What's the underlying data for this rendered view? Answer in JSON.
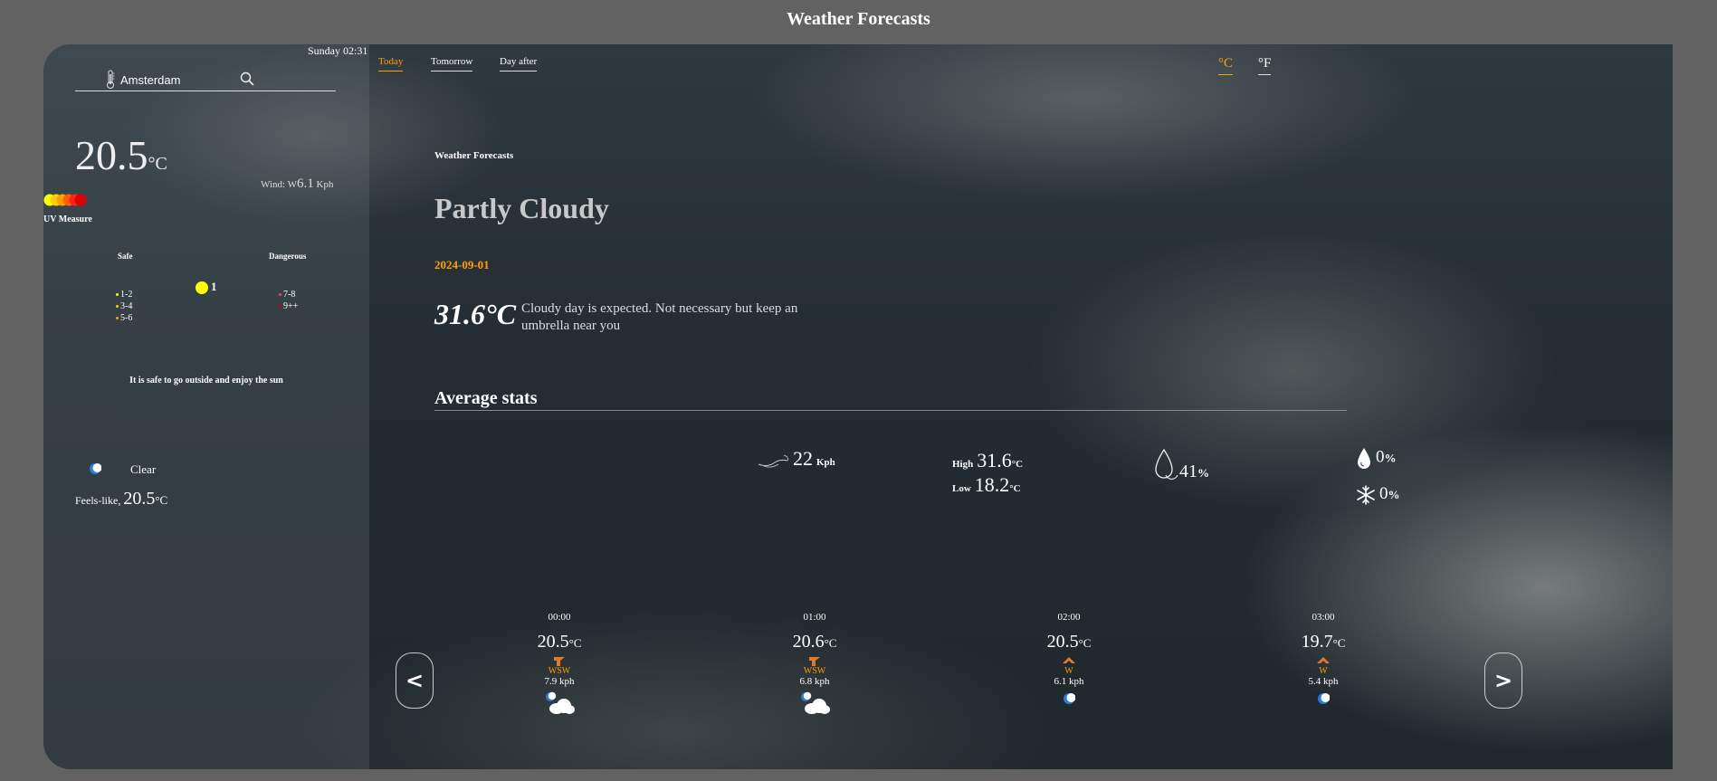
{
  "page": {
    "title": "Weather Forecasts"
  },
  "sidebar": {
    "datetime": "Sunday 02:31",
    "search": {
      "value": "Amsterdam"
    },
    "current_temp": "20.5",
    "temp_unit": "°C",
    "wind": {
      "prefix": "Wind: W",
      "value": "6.1",
      "unit": "Kph"
    },
    "uv": {
      "title": "UV Measure",
      "safe_label": "Safe",
      "danger_label": "Dangerous",
      "safe_levels": [
        "1-2",
        "3-4",
        "5-6"
      ],
      "danger_levels": [
        "7-8",
        "9++"
      ],
      "current": "1",
      "message": "It is safe to go outside and enjoy the sun"
    },
    "condition": "Clear",
    "feels_like": {
      "label": "Feels-like,",
      "value": "20.5",
      "unit": "°C"
    }
  },
  "tabs": [
    {
      "label": "Today",
      "active": true
    },
    {
      "label": "Tomorrow",
      "active": false
    },
    {
      "label": "Day after",
      "active": false
    }
  ],
  "units": [
    {
      "label": "°C",
      "active": true
    },
    {
      "label": "°F",
      "active": false
    }
  ],
  "forecast": {
    "label": "Weather Forecasts",
    "condition": "Partly Cloudy",
    "date": "2024-09-01",
    "temp": "31.6°C",
    "description": "Cloudy day is expected. Not necessary but keep an umbrella near you"
  },
  "average": {
    "title": "Average stats",
    "wind": {
      "value": "22",
      "unit": "Kph"
    },
    "high": {
      "label": "High",
      "value": "31.6",
      "unit": "°C"
    },
    "low": {
      "label": "Low",
      "value": "18.2",
      "unit": "°C"
    },
    "humidity": {
      "value": "41",
      "unit": "%"
    },
    "rain": {
      "value": "0",
      "unit": "%"
    },
    "snow": {
      "value": "0",
      "unit": "%"
    }
  },
  "nav": {
    "prev": "<",
    "next": ">"
  },
  "hourly": [
    {
      "time": "00:00",
      "temp": "20.5",
      "unit": "°C",
      "dir": "WSW",
      "speed": "7.9 kph",
      "cloudy": true
    },
    {
      "time": "01:00",
      "temp": "20.6",
      "unit": "°C",
      "dir": "WSW",
      "speed": "6.8 kph",
      "cloudy": true
    },
    {
      "time": "02:00",
      "temp": "20.5",
      "unit": "°C",
      "dir": "W",
      "speed": "6.1 kph",
      "cloudy": false
    },
    {
      "time": "03:00",
      "temp": "19.7",
      "unit": "°C",
      "dir": "W",
      "speed": "5.4 kph",
      "cloudy": false
    }
  ],
  "colors": {
    "accent": "#ff9f00",
    "background": "#626262",
    "uv_current": "#ffff00"
  }
}
